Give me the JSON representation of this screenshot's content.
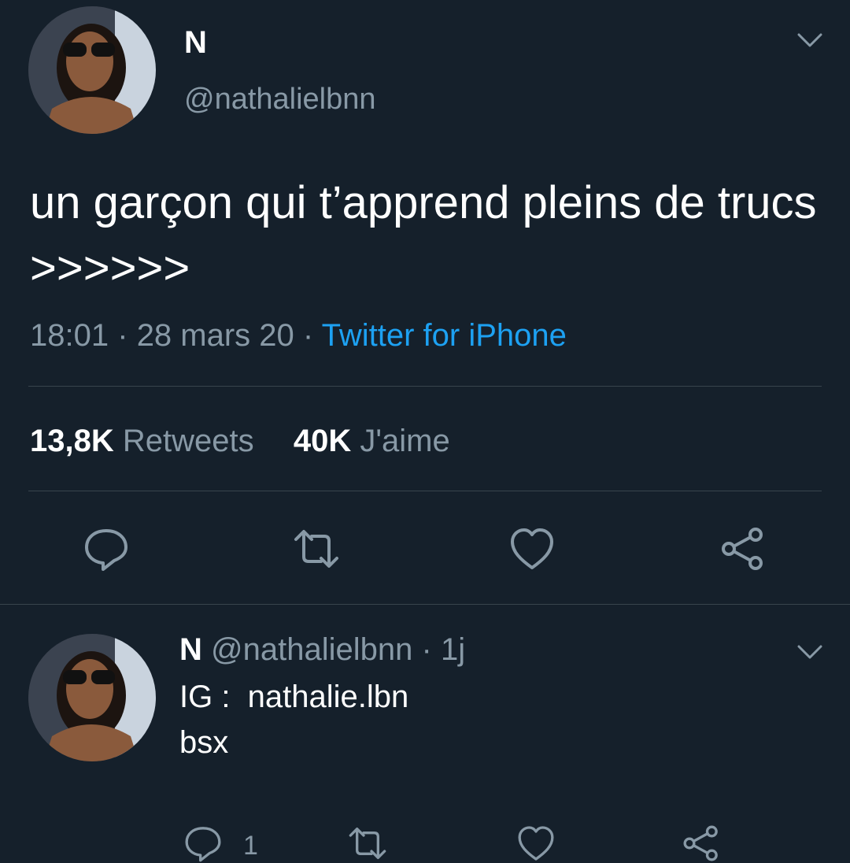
{
  "main_tweet": {
    "name": "N",
    "handle": "@nathalielbnn",
    "text": "un garçon qui t’apprend pleins de trucs >>>>>>",
    "time": "18:01",
    "date": "28 mars 20",
    "separator": "·",
    "source": "Twitter for iPhone",
    "retweets_count": "13,8K",
    "retweets_label": "Retweets",
    "likes_count": "40K",
    "likes_label": "J'aime"
  },
  "reply": {
    "name": "N",
    "handle": "@nathalielbnn",
    "separator": "·",
    "age": "1j",
    "line1": "IG :  nathalie.lbn",
    "line2": "bsx",
    "reply_count": "1"
  },
  "icons": {
    "menu": "chevron-down-icon",
    "reply": "comment-icon",
    "retweet": "retweet-icon",
    "like": "heart-icon",
    "share": "share-icon"
  },
  "colors": {
    "background": "#15202b",
    "text_primary": "#ffffff",
    "text_secondary": "#8899a6",
    "link": "#1da1f2",
    "divider": "#38444d"
  }
}
